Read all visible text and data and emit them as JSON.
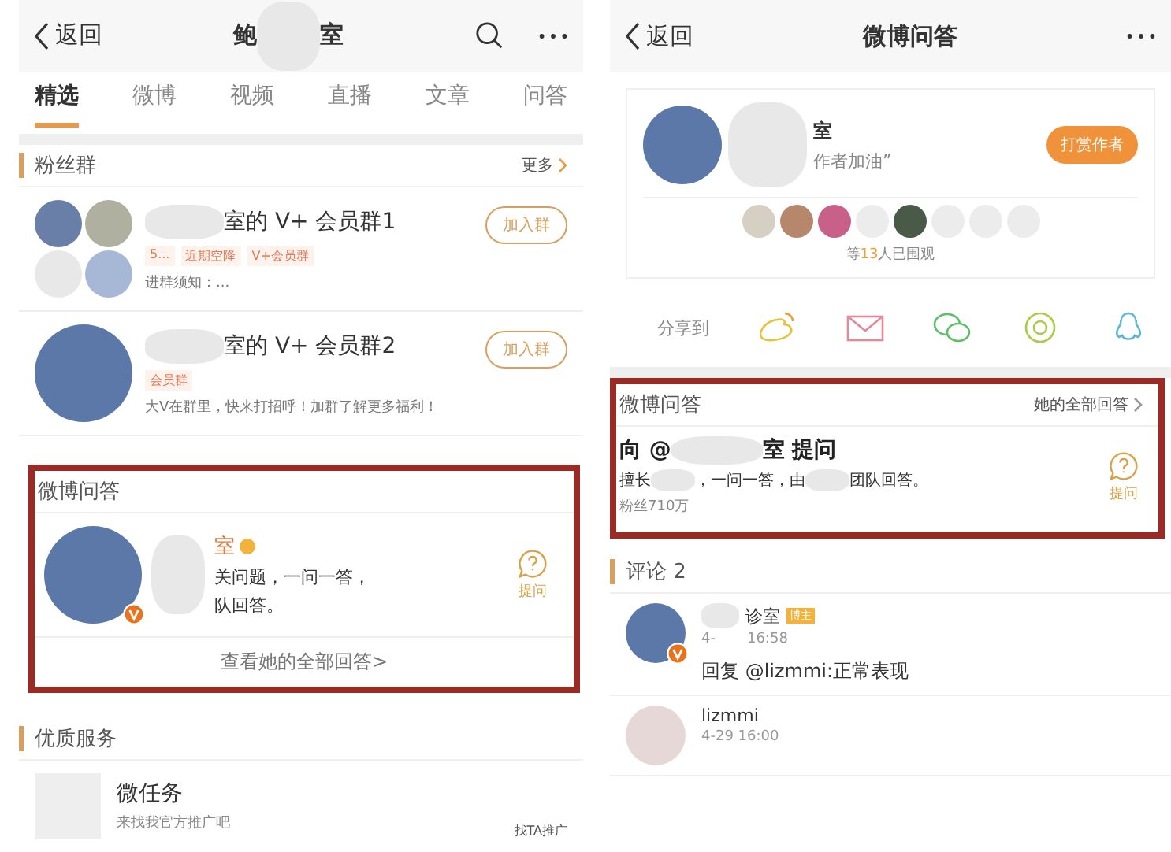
{
  "left": {
    "nav": {
      "back": "返回",
      "title_parts": [
        "鲍",
        "室"
      ]
    },
    "tabs": [
      {
        "label": "精选",
        "selected": true
      },
      {
        "label": "微博",
        "selected": false
      },
      {
        "label": "视频",
        "selected": false
      },
      {
        "label": "直播",
        "selected": false
      },
      {
        "label": "文章",
        "selected": false
      },
      {
        "label": "问答",
        "selected": false
      }
    ],
    "fan_groups": {
      "title": "粉丝群",
      "more": "更多",
      "groups": [
        {
          "kind": "multi",
          "name": "室的 V+ 会员群1",
          "tags": [
            "5...",
            "近期空降",
            "V+会员群"
          ],
          "desc": "进群须知：...",
          "button": "加入群"
        },
        {
          "kind": "single",
          "name": "室的 V+ 会员群2",
          "tags": [
            "会员群"
          ],
          "desc": "大V在群里，快来打招呼！加群了解更多福利！",
          "button": "加入群"
        }
      ]
    },
    "qa": {
      "title": "微博问答",
      "name": "室",
      "line1": "关问题，一问一答，",
      "line2": "队回答。",
      "ask": "提问",
      "link": "查看她的全部回答>"
    },
    "services": {
      "title": "优质服务",
      "name": "微任务",
      "desc": "来找我官方推广吧",
      "action": "找TA推广"
    }
  },
  "right": {
    "nav": {
      "back": "返回",
      "title": "微博问答"
    },
    "reward": {
      "name": "室",
      "subtitle": "作者加油”",
      "button": "打赏作者",
      "viewers_prefix": "等",
      "viewers_count": "13",
      "viewers_suffix": "人已围观"
    },
    "share": {
      "label": "分享到"
    },
    "qa": {
      "title": "微博问答",
      "link": "她的全部回答",
      "ask_prefix": "向 @",
      "ask_suffix": "室 提问",
      "desc_parts": [
        "擅长",
        "，一问一答，由",
        "团队回答。"
      ],
      "fans": "粉丝710万",
      "ask": "提问"
    },
    "comments": {
      "title": "评论 2",
      "items": [
        {
          "name": "诊室",
          "badge": "博主",
          "time_parts": [
            "4-",
            "16:58"
          ],
          "text": "回复 @lizmmi:正常表现"
        },
        {
          "name": "lizmmi",
          "time_parts": [
            "4-29 16:00"
          ]
        }
      ]
    }
  }
}
